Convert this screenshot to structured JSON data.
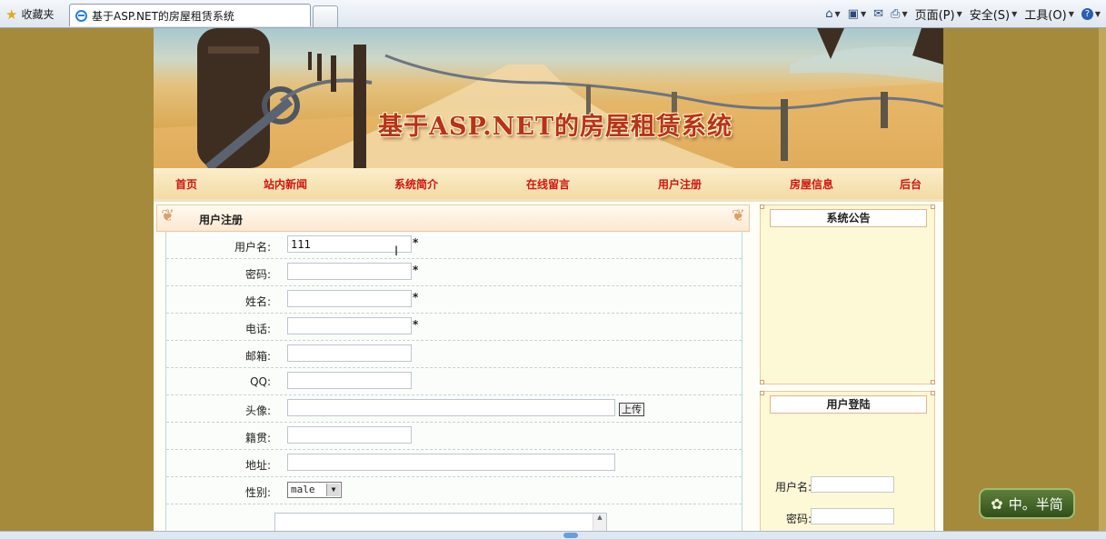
{
  "browser": {
    "favorites_label": "收藏夹",
    "tab_title": "基于ASP.NET的房屋租赁系统",
    "menus": [
      "页面(P)",
      "安全(S)",
      "工具(O)"
    ]
  },
  "banner": {
    "title": "基于ASP.NET的房屋租赁系统"
  },
  "nav": {
    "items": [
      "首页",
      "站内新闻",
      "系统简介",
      "在线留言",
      "用户注册",
      "房屋信息",
      "后台"
    ]
  },
  "register": {
    "title": "用户注册",
    "fields": [
      {
        "label": "用户名:",
        "value": "111",
        "required": "*"
      },
      {
        "label": "密码:",
        "value": "",
        "required": "*"
      },
      {
        "label": "姓名:",
        "value": "",
        "required": "*"
      },
      {
        "label": "电话:",
        "value": "",
        "required": "*"
      },
      {
        "label": "邮箱:",
        "value": ""
      },
      {
        "label": "QQ:",
        "value": ""
      },
      {
        "label": "头像:",
        "value": "",
        "button": "上传"
      },
      {
        "label": "籍贯:",
        "value": ""
      },
      {
        "label": "地址:",
        "value": ""
      },
      {
        "label": "性别:",
        "value": "male"
      }
    ]
  },
  "side": {
    "notice_title": "系统公告",
    "login_title": "用户登陆",
    "username_label": "用户名:",
    "password_label": "密码:"
  },
  "ime": {
    "text": "中。半简"
  },
  "colors": {
    "page_bg": "#a58a3c",
    "nav_text": "#d1140e",
    "banner_title": "#b8321a"
  }
}
